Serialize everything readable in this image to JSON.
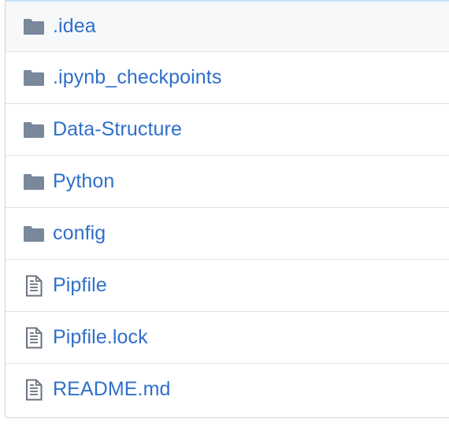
{
  "file_list": {
    "items": [
      {
        "name": "folder-row",
        "label": ".idea",
        "icon": "folder-icon"
      },
      {
        "name": "folder-row",
        "label": ".ipynb_checkpoints",
        "icon": "folder-icon"
      },
      {
        "name": "folder-row",
        "label": "Data-Structure",
        "icon": "folder-icon"
      },
      {
        "name": "folder-row",
        "label": "Python",
        "icon": "folder-icon"
      },
      {
        "name": "folder-row",
        "label": "config",
        "icon": "folder-icon"
      },
      {
        "name": "file-row",
        "label": "Pipfile",
        "icon": "file-text-icon"
      },
      {
        "name": "file-row",
        "label": "Pipfile.lock",
        "icon": "file-text-icon"
      },
      {
        "name": "file-row",
        "label": "README.md",
        "icon": "file-text-icon"
      }
    ]
  },
  "colors": {
    "link": "#2f6fcb",
    "folder_icon": "#79889b",
    "file_icon": "#6a737d",
    "row_border": "#e1e4e8",
    "highlight_row": "#f6f8fa"
  }
}
